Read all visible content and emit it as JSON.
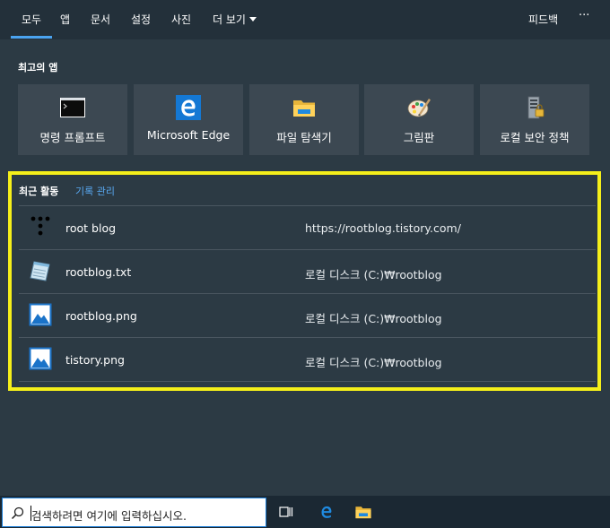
{
  "tabs": {
    "all": "모두",
    "apps": "앱",
    "documents": "문서",
    "settings": "설정",
    "photos": "사진",
    "more": "더 보기",
    "feedback": "피드백",
    "menu": "···"
  },
  "top_apps": {
    "title": "최고의 앱",
    "items": [
      {
        "label": "명령 프롬프트",
        "icon": "command-prompt-icon"
      },
      {
        "label": "Microsoft Edge",
        "icon": "edge-icon"
      },
      {
        "label": "파일 탐색기",
        "icon": "file-explorer-icon"
      },
      {
        "label": "그림판",
        "icon": "paint-icon"
      },
      {
        "label": "로컬 보안 정책",
        "icon": "security-policy-icon"
      }
    ]
  },
  "recent": {
    "title": "최근 활동",
    "history_link": "기록 관리",
    "items": [
      {
        "name": "root blog",
        "location": "https://rootblog.tistory.com/",
        "icon": "tistory-icon"
      },
      {
        "name": "rootblog.txt",
        "location": "로컬 디스크 (C:)₩rootblog",
        "icon": "notepad-icon"
      },
      {
        "name": "rootblog.png",
        "location": "로컬 디스크 (C:)₩rootblog",
        "icon": "image-file-icon"
      },
      {
        "name": "tistory.png",
        "location": "로컬 디스크 (C:)₩rootblog",
        "icon": "image-file-icon"
      }
    ]
  },
  "taskbar": {
    "search_placeholder": "검색하려면 여기에 입력하십시오.",
    "icons": [
      "task-view-icon",
      "edge-icon",
      "file-explorer-icon"
    ]
  },
  "colors": {
    "accent": "#4aa3f0",
    "highlight_border": "#f5ef1a",
    "background": "#2c3a44",
    "link": "#58a8f0"
  }
}
